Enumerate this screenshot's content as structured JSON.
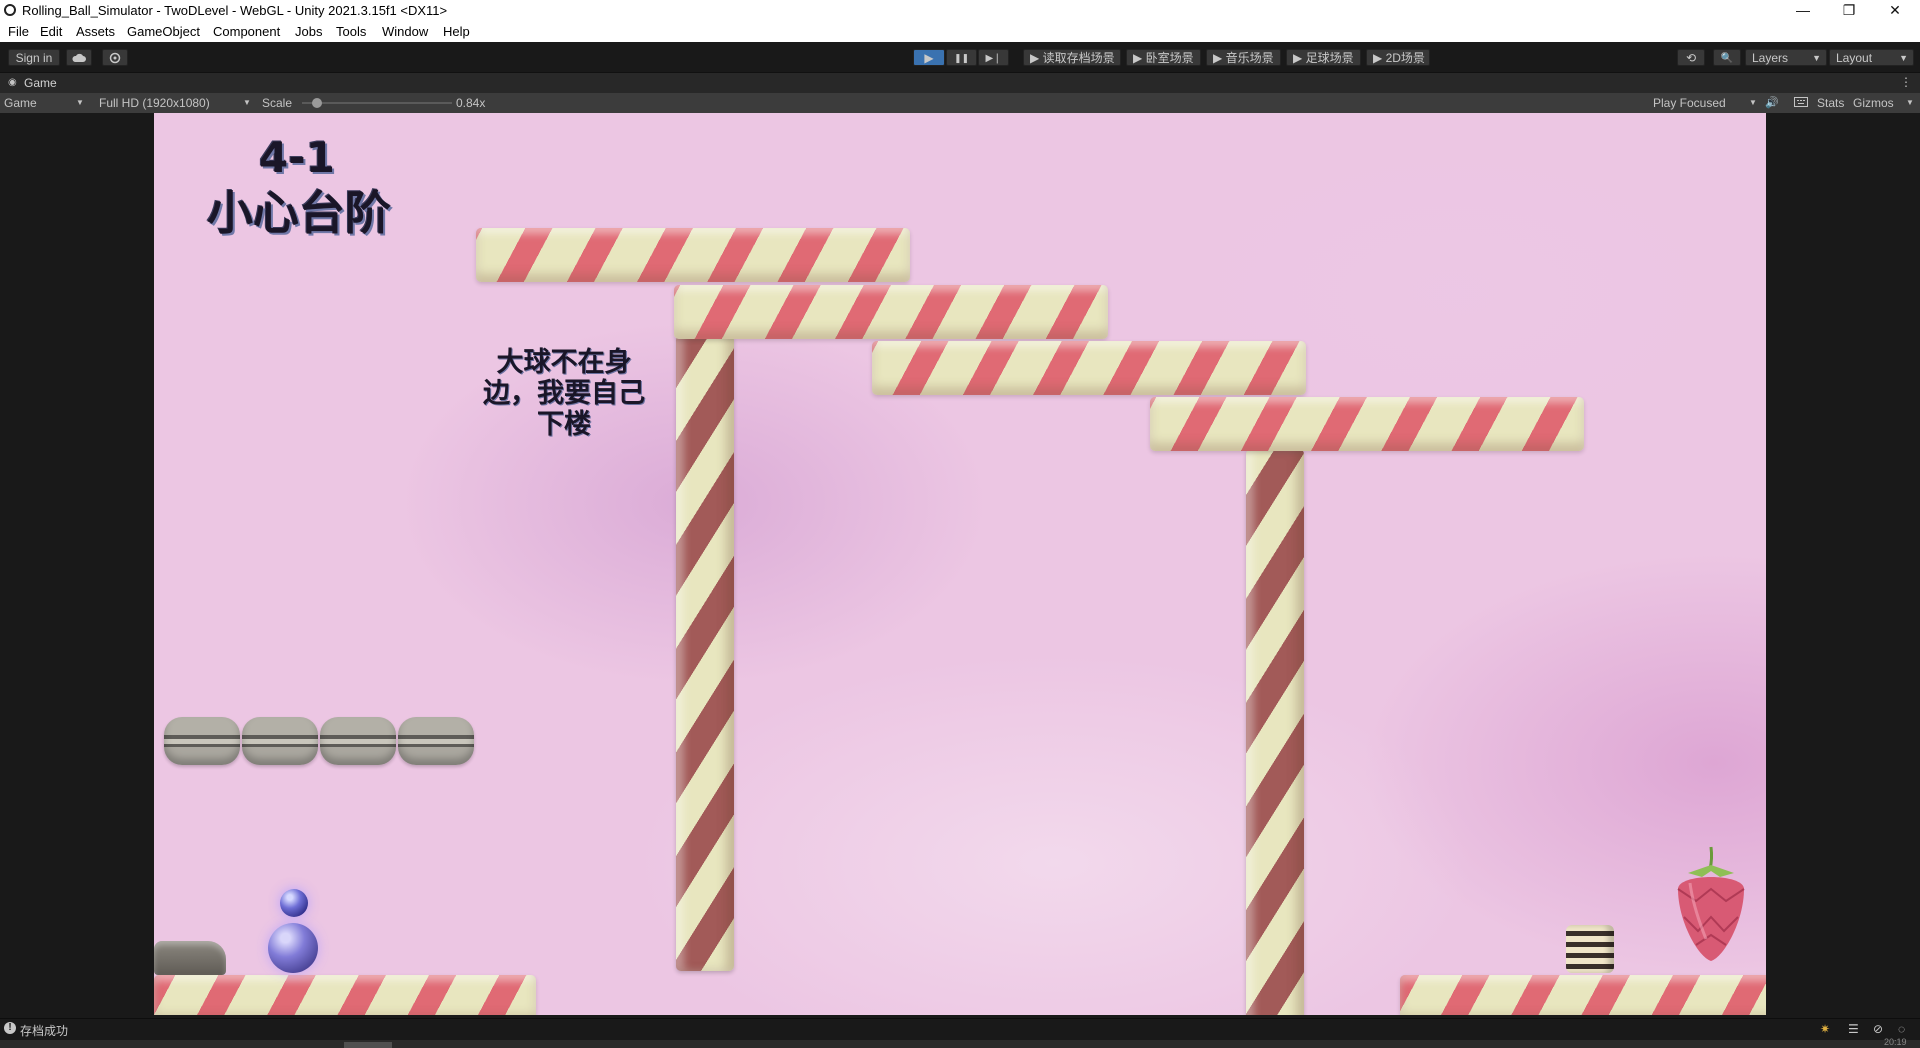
{
  "window": {
    "title": "Rolling_Ball_Simulator - TwoDLevel - WebGL - Unity 2021.3.15f1 <DX11>",
    "minimize_glyph": "—",
    "restore_glyph": "❐",
    "close_glyph": "✕"
  },
  "menu": [
    "File",
    "Edit",
    "Assets",
    "GameObject",
    "Component",
    "Jobs",
    "Tools",
    "Window",
    "Help"
  ],
  "toolbar": {
    "sign_in": "Sign in",
    "cloud_icon": "cloud-icon",
    "collab_icon": "collab-icon",
    "play_glyph": "▶",
    "pause_glyph": "❚❚",
    "step_glyph": "▶❘",
    "scene_buttons": [
      "▶ 读取存档场景",
      "▶ 卧室场景",
      "▶ 音乐场景",
      "▶ 足球场景",
      "▶ 2D场景"
    ],
    "history_glyph": "⟲",
    "search_glyph": "🔍",
    "layers": "Layers",
    "layout": "Layout"
  },
  "tab": {
    "label": "Game",
    "menu_glyph": "⋮"
  },
  "game_bar": {
    "display": "Game",
    "resolution": "Full HD (1920x1080)",
    "scale_label": "Scale",
    "scale_value": "0.84x",
    "scale_fraction": 0.1,
    "play_mode": "Play Focused",
    "stats": "Stats",
    "gizmos": "Gizmos"
  },
  "game": {
    "level_number": "4-1",
    "level_name": "小心台阶",
    "hint_lines": [
      "大球不在身",
      "边，我要自己",
      "下楼"
    ]
  },
  "status": {
    "message": "存档成功",
    "time_partial": "20:19"
  }
}
